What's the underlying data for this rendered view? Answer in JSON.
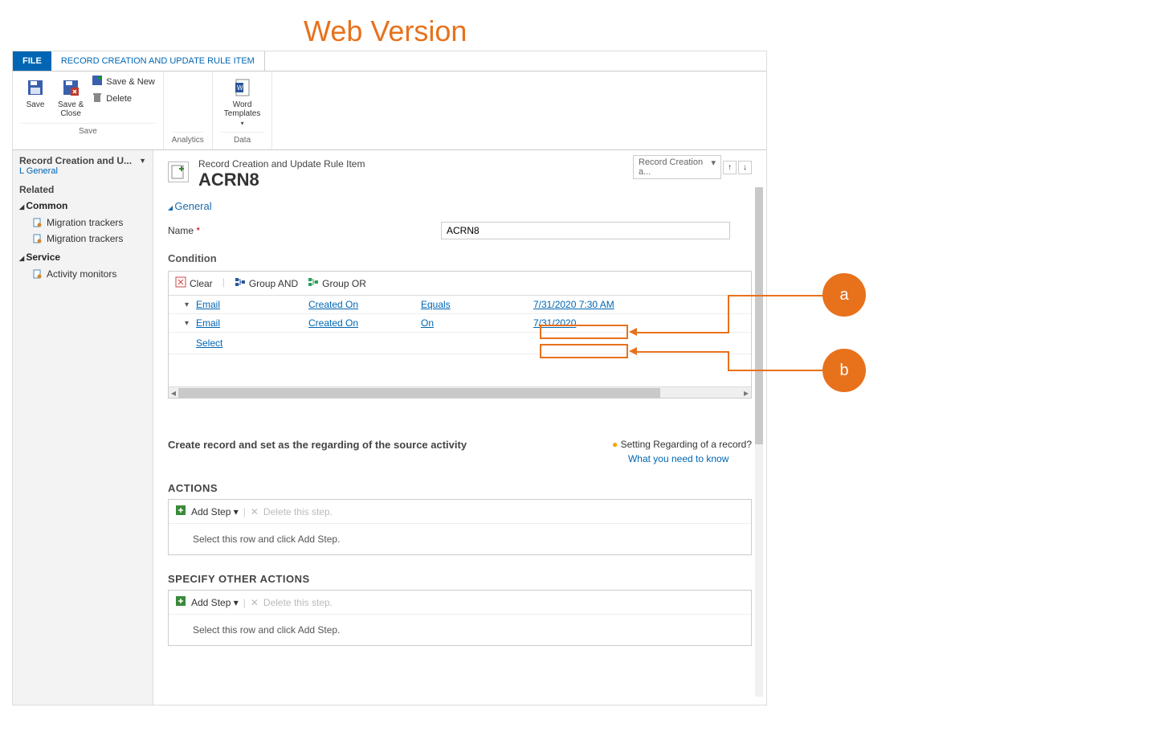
{
  "annotation": {
    "title": "Web Version",
    "badges": {
      "a": "a",
      "b": "b"
    }
  },
  "ribbon": {
    "tabs": {
      "file": "FILE",
      "entity": "RECORD CREATION AND UPDATE RULE ITEM"
    },
    "save_group": {
      "save": "Save",
      "save_close": "Save &\nClose",
      "save_new": "Save & New",
      "delete": "Delete",
      "label": "Save"
    },
    "analytics_label": "Analytics",
    "data_group": {
      "word_templates": "Word\nTemplates",
      "label": "Data"
    }
  },
  "left_nav": {
    "head": "Record Creation and U...",
    "subhead": "L General",
    "related": "Related",
    "common": "Common",
    "mig1": "Migration trackers",
    "mig2": "Migration trackers",
    "service": "Service",
    "activity": "Activity monitors"
  },
  "header": {
    "entity_type": "Record Creation and Update Rule Item",
    "record_name": "ACRN8",
    "selector": "Record Creation a..."
  },
  "form": {
    "section_general": "General",
    "name_label": "Name",
    "name_value": "ACRN8",
    "condition_title": "Condition",
    "toolbar": {
      "clear": "Clear",
      "and": "Group AND",
      "or": "Group OR"
    },
    "rows": [
      {
        "entity": "Email",
        "field": "Created On",
        "op": "Equals",
        "val": "7/31/2020 7:30 AM"
      },
      {
        "entity": "Email",
        "field": "Created On",
        "op": "On",
        "val": "7/31/2020"
      }
    ],
    "select_row": "Select",
    "create_record_text": "Create record and set as the regarding of the source activity",
    "setting_regarding": "Setting Regarding of a record?",
    "what_you_need": "What you need to know",
    "actions_title": "ACTIONS",
    "specify_other": "SPECIFY OTHER ACTIONS",
    "add_step": "Add Step",
    "delete_step": "Delete this step.",
    "select_row_add": "Select this row and click Add Step."
  }
}
